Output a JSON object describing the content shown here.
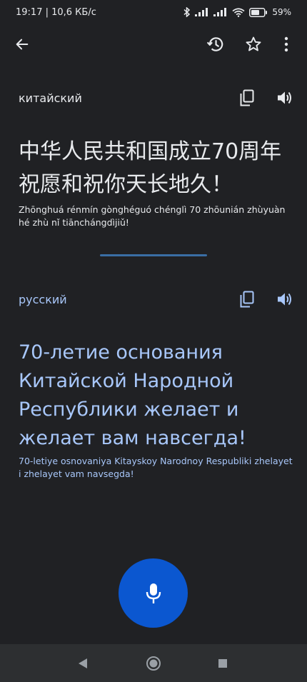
{
  "status_bar": {
    "time_speed": "19:17 | 10,6 КБ/с",
    "battery": "59%"
  },
  "source": {
    "language": "китайский",
    "text": "中华人民共和国成立70周年 祝愿和祝你天长地久！",
    "romanization": "Zhōnghuá rénmín gònghéguó chénglì 70 zhōunián zhùyuàn hé zhù nǐ tiānchángdìjiǔ!"
  },
  "target": {
    "language": "русский",
    "text": "70-летие основания Китайской Народной Республики желает и желает вам навсегда!",
    "romanization": "70-letiye osnovaniya Kitayskoy Narodnoy Respubliki zhelayet i zhelayet vam navsegda!"
  },
  "icons": {
    "back": "arrow-back-icon",
    "history": "history-icon",
    "favorite": "star-icon",
    "menu": "more-vert-icon",
    "copy": "copy-icon",
    "speak": "volume-icon",
    "mic": "mic-icon"
  },
  "colors": {
    "background": "#202124",
    "text": "#e8eaed",
    "accent_text": "#a8c7fa",
    "mic": "#0b57d0",
    "navbar": "#2d2f31"
  }
}
